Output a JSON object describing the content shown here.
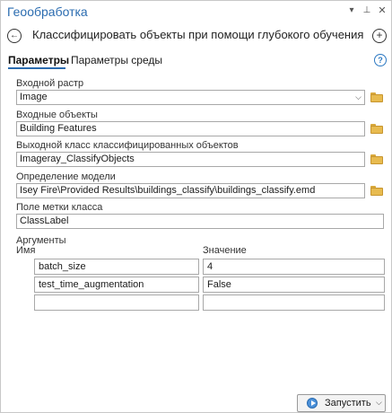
{
  "window": {
    "title": "Геообработка",
    "menu_icon": "chevron-down",
    "pin_icon": "pin",
    "close_icon": "close"
  },
  "header": {
    "tool_title": "Классифицировать объекты при помощи глубокого обучения"
  },
  "tabs": [
    {
      "label": "Параметры",
      "active": true
    },
    {
      "label": "Параметры среды",
      "active": false
    }
  ],
  "params": {
    "input_raster": {
      "label": "Входной растр",
      "value": "Image"
    },
    "input_features": {
      "label": "Входные объекты",
      "value": "Building Features"
    },
    "output_class": {
      "label": "Выходной класс классифицированных объектов",
      "value": "Imageray_ClassifyObjects"
    },
    "model_def": {
      "label": "Определение модели",
      "value": "Isey Fire\\Provided Results\\buildings_classify\\buildings_classify.emd"
    },
    "class_label_field": {
      "label": "Поле метки класса",
      "value": "ClassLabel"
    }
  },
  "arguments": {
    "section_label": "Аргументы",
    "col_name": "Имя",
    "col_value": "Значение",
    "rows": [
      {
        "name": "batch_size",
        "value": "4"
      },
      {
        "name": "test_time_augmentation",
        "value": "False"
      },
      {
        "name": "",
        "value": ""
      }
    ]
  },
  "run_button": {
    "label": "Запустить"
  },
  "colors": {
    "accent": "#2b6cb0",
    "folder": "#e8bb4f"
  }
}
